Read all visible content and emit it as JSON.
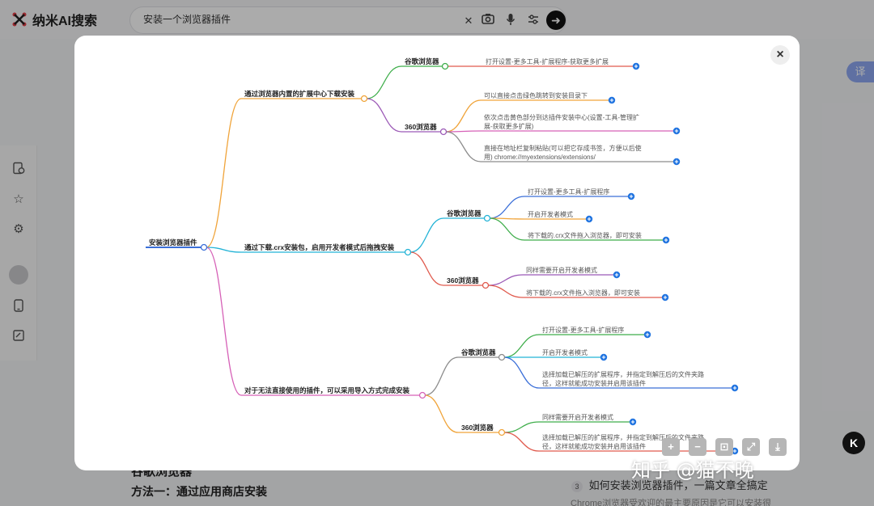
{
  "app": {
    "name": "纳米AI搜索"
  },
  "search": {
    "value": "安装一个浏览器插件"
  },
  "icons": {
    "clear": "close-icon",
    "camera": "camera-icon",
    "mic": "microphone-icon",
    "settings": "sliders-icon",
    "go": "arrow-right-icon"
  },
  "background": {
    "heading1": "谷歌浏览器",
    "heading2": "方法一：通过应用商店安装",
    "related_num": "3",
    "related_text": "如何安装浏览器插件，一篇文章全搞定",
    "snippet": "Chrome浏览器受欢迎的最主要原因是它可以安装很"
  },
  "translate": {
    "label": "译"
  },
  "modal": {
    "close_label": "×",
    "mindmap": {
      "root": "安装浏览器插件",
      "b1": {
        "label": "通过浏览器内置的扩展中心下载安装",
        "chrome": {
          "label": "谷歌浏览器",
          "items": [
            "打开设置-更多工具-扩展程序-获取更多扩展"
          ]
        },
        "s360": {
          "label": "360浏览器",
          "items": [
            [
              "可以直接点击绿色跳转到安装目录下"
            ],
            [
              "依次点击黄色部分到达插件安装中心(设置-工具-管理扩",
              "展-获取更多扩展)"
            ],
            [
              "直接在地址栏复制粘贴(可以把它存成书签，方便以后使",
              "用) chrome://myextensions/extensions/"
            ]
          ]
        }
      },
      "b2": {
        "label": "通过下载.crx安装包，启用开发者模式后拖拽安装",
        "chrome": {
          "label": "谷歌浏览器",
          "items": [
            "打开设置-更多工具-扩展程序",
            "开启开发者模式",
            "将下载的.crx文件拖入浏览器，即可安装"
          ]
        },
        "s360": {
          "label": "360浏览器",
          "items": [
            "同样需要开启开发者模式",
            "将下载的.crx文件拖入浏览器，即可安装"
          ]
        }
      },
      "b3": {
        "label": "对于无法直接使用的插件，可以采用导入方式完成安装",
        "chrome": {
          "label": "谷歌浏览器",
          "items": [
            [
              "打开设置-更多工具-扩展程序"
            ],
            [
              "开启开发者模式"
            ],
            [
              "选择加载已解压的扩展程序，并指定到解压后的文件夹路",
              "径，这样就能成功安装并启用该插件"
            ]
          ]
        },
        "s360": {
          "label": "360浏览器",
          "items": [
            [
              "同样需要开启开发者模式"
            ],
            [
              "选择加载已解压的扩展程序，并指定到解压后的文件夹路",
              "径，这样就能成功安装并启用该插件"
            ]
          ]
        }
      }
    },
    "toolbar": {
      "zoom_in": "+",
      "zoom_out": "−",
      "fit": "⊡",
      "fullscreen": "⤢",
      "download": "⤓"
    }
  },
  "watermark": {
    "text": "知乎 @猫不晚",
    "logo": "K"
  },
  "colors": {
    "orange": "#f0a43a",
    "green": "#3fae4b",
    "purple": "#9b59b6",
    "red": "#e05a4d",
    "cyan": "#23b3d6",
    "teal": "#2a9d8f",
    "blue": "#3b6fd8",
    "magenta": "#d661b7",
    "gray": "#8c8c8c",
    "expand": "#1f73e0"
  }
}
